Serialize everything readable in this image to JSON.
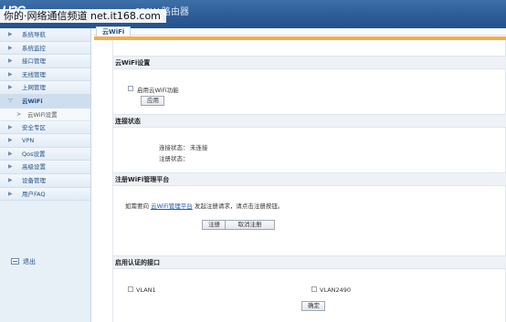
{
  "header": {
    "logo": "H3C",
    "product": "350W 路由器",
    "watermark": "你的·网络通信频道 net.it168.com"
  },
  "sidebar": {
    "items": [
      {
        "label": "系统导航"
      },
      {
        "label": "系统监控"
      },
      {
        "label": "接口管理"
      },
      {
        "label": "无线管理"
      },
      {
        "label": "上网管理"
      },
      {
        "label": "云WiFi",
        "sub": "云WiFi设置"
      },
      {
        "label": "安全专区"
      },
      {
        "label": "VPN"
      },
      {
        "label": "Qos设置"
      },
      {
        "label": "高级设置"
      },
      {
        "label": "设备管理"
      },
      {
        "label": "用户FAQ"
      }
    ],
    "logout": "退出"
  },
  "main": {
    "tab": "云WiFi",
    "cloud_section": {
      "title": "云WiFi设置",
      "enable_label": "启用云WiFi功能",
      "apply_button": "应用"
    },
    "status_section": {
      "title": "连接状态",
      "connect_label": "连接状态：",
      "connect_value": "未连接",
      "register_label": "注册状态：",
      "register_value": ""
    },
    "register_section": {
      "title": "注册WiFi管理平台",
      "text_before": "如需要向",
      "link": "云WiFi管理平台",
      "text_after": "发起注册请求，请点击注册按钮。",
      "register_button": "注册",
      "cancel_button": "取消注册"
    },
    "interface_section": {
      "title": "启用认证的接口",
      "vlans": [
        "VLAN1",
        "VLAN2490"
      ],
      "confirm_button": "确定"
    }
  }
}
